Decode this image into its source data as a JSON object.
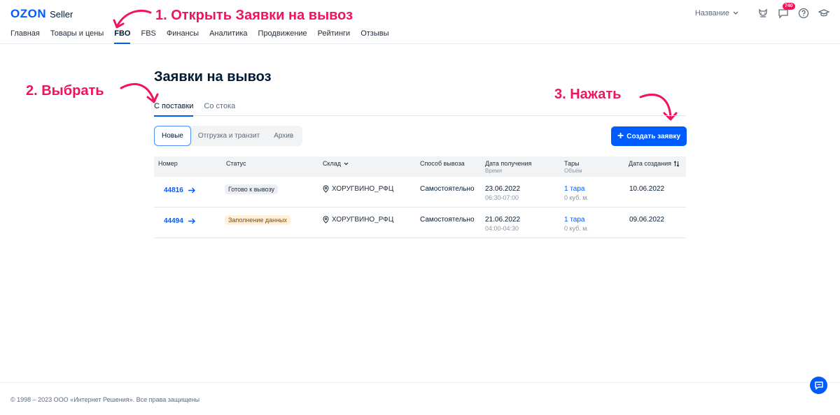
{
  "header": {
    "logo": "OZON",
    "logo_suffix": "Seller",
    "nav": [
      "Главная",
      "Товары и цены",
      "FBO",
      "FBS",
      "Финансы",
      "Аналитика",
      "Продвижение",
      "Рейтинги",
      "Отзывы"
    ],
    "active_nav": "FBO",
    "name_selector": "Название",
    "notifications_badge": "740"
  },
  "annotations": {
    "step1": "1. Открыть Заявки на вывоз",
    "step2": "2. Выбрать",
    "step3": "3. Нажать"
  },
  "page": {
    "title": "Заявки на вывоз",
    "tabs": [
      "С поставки",
      "Со стока"
    ],
    "filters": [
      "Новые",
      "Отгрузка и транзит",
      "Архив"
    ],
    "create_button": "Создать заявку"
  },
  "table": {
    "headers": {
      "number": "Номер",
      "status": "Статус",
      "warehouse": "Склад",
      "method": "Способ вывоза",
      "receive_date": "Дата получения",
      "receive_time": "Время",
      "boxes": "Тары",
      "volume": "Объём",
      "created": "Дата создания"
    },
    "rows": [
      {
        "number": "44816",
        "status": "Готово к вывозу",
        "warehouse": "ХОРУГВИНО_РФЦ",
        "method": "Самостоятельно",
        "date": "23.06.2022",
        "time": "06:30-07:00",
        "boxes": "1 тара",
        "volume": "0 куб. м.",
        "created": "10.06.2022"
      },
      {
        "number": "44494",
        "status": "Заполнение данных",
        "warehouse": "ХОРУГВИНО_РФЦ",
        "method": "Самостоятельно",
        "date": "21.06.2022",
        "time": "04:00-04:30",
        "boxes": "1 тара",
        "volume": "0 куб. м.",
        "created": "09.06.2022"
      }
    ]
  },
  "footer": {
    "copyright": "© 1998 – 2023 ООО «Интернет Решения». Все права защищены"
  },
  "colors": {
    "brand": "#005bff",
    "annotation": "#f1135e",
    "badge": "#f91155"
  }
}
